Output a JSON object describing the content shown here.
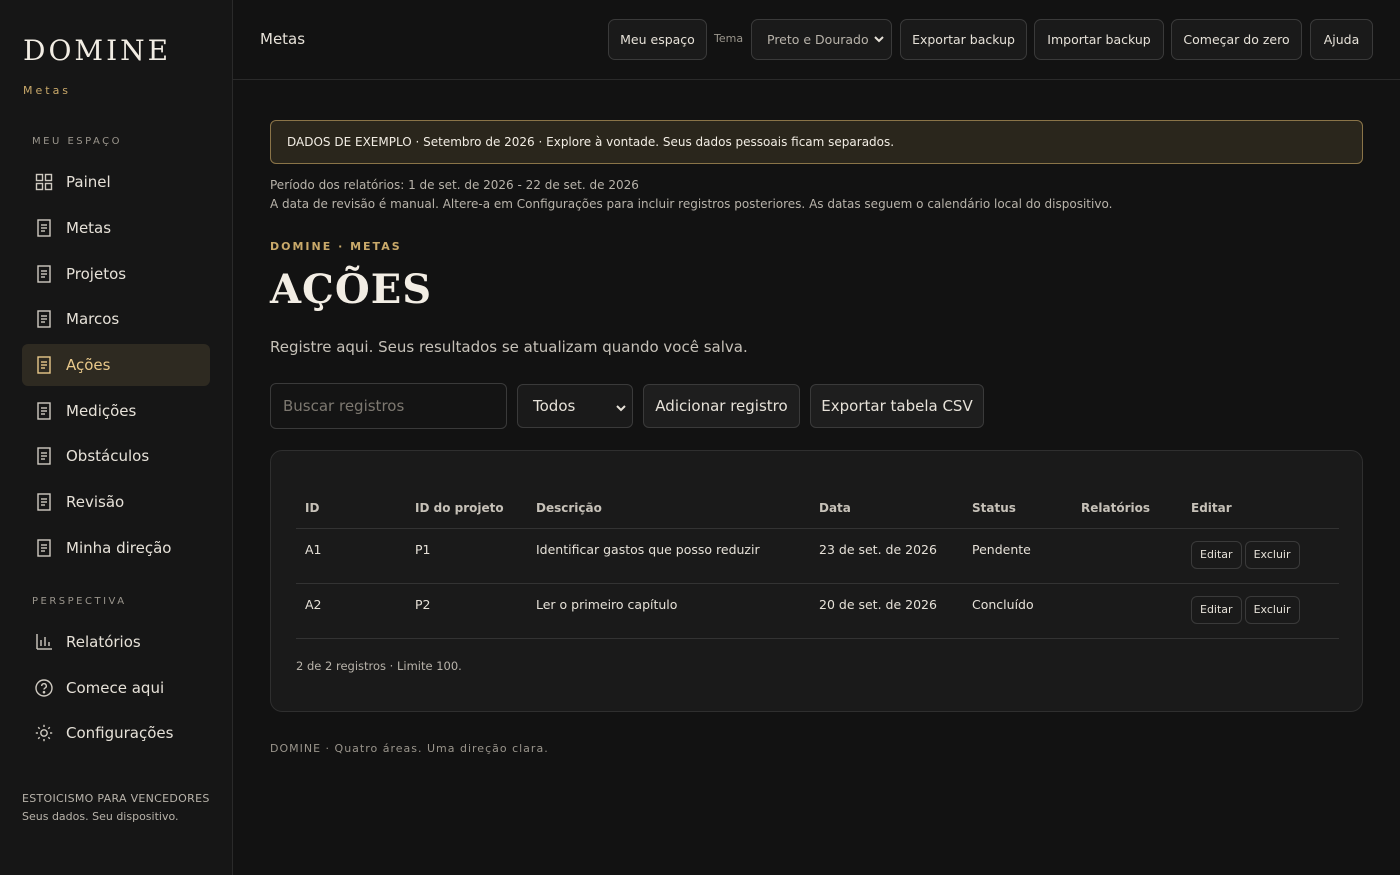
{
  "sidebar": {
    "brand": "DOMINE",
    "brand_sub": "Metas",
    "section_my_space": "MEU ESPAÇO",
    "section_perspective": "PERSPECTIVA",
    "items": [
      {
        "label": "Painel",
        "icon": "grid-icon"
      },
      {
        "label": "Metas",
        "icon": "document-icon"
      },
      {
        "label": "Projetos",
        "icon": "document-icon"
      },
      {
        "label": "Marcos",
        "icon": "document-icon"
      },
      {
        "label": "Ações",
        "icon": "document-icon",
        "active": true
      },
      {
        "label": "Medições",
        "icon": "document-icon"
      },
      {
        "label": "Obstáculos",
        "icon": "document-icon"
      },
      {
        "label": "Revisão",
        "icon": "document-icon"
      },
      {
        "label": "Minha direção",
        "icon": "document-icon"
      }
    ],
    "perspective_items": [
      {
        "label": "Relatórios",
        "icon": "bar-chart-icon"
      },
      {
        "label": "Comece aqui",
        "icon": "help-circle-icon"
      },
      {
        "label": "Configurações",
        "icon": "sun-settings-icon"
      }
    ],
    "footer_line1": "ESTOICISMO PARA VENCEDORES",
    "footer_line2": "Seus dados. Seu dispositivo."
  },
  "topbar": {
    "title": "Metas",
    "my_space": "Meu espaço",
    "theme_label": "Tema",
    "theme_value": "Preto e Dourado",
    "export_backup": "Exportar backup",
    "import_backup": "Importar backup",
    "start_over": "Começar do zero",
    "help": "Ajuda"
  },
  "banner": "DADOS DE EXEMPLO · Setembro de 2026 · Explore à vontade. Seus dados pessoais ficam separados.",
  "report_period": "Período dos relatórios: 1 de set. de 2026 - 22 de set. de 2026",
  "review_note": "A data de revisão é manual. Altere-a em Configurações para incluir registros posteriores. As datas seguem o calendário local do dispositivo.",
  "eyebrow": "DOMINE · METAS",
  "page_title": "AÇÕES",
  "subtitle": "Registre aqui. Seus resultados se atualizam quando você salva.",
  "search_placeholder": "Buscar registros",
  "filter_value": "Todos",
  "add_record": "Adicionar registro",
  "export_csv": "Exportar tabela CSV",
  "table": {
    "headers": [
      "ID",
      "ID do projeto",
      "Descrição",
      "Data",
      "Status",
      "Relatórios",
      "Editar"
    ],
    "rows": [
      {
        "id": "A1",
        "project": "P1",
        "desc": "Identificar gastos que posso reduzir",
        "date": "23 de set. de 2026",
        "status": "Pendente",
        "reports": "",
        "edit": "Editar",
        "delete": "Excluir"
      },
      {
        "id": "A2",
        "project": "P2",
        "desc": "Ler o primeiro capítulo",
        "date": "20 de set. de 2026",
        "status": "Concluído",
        "reports": "",
        "edit": "Editar",
        "delete": "Excluir"
      }
    ],
    "count": "2 de 2 registros · Limite 100."
  },
  "footer": "DOMINE · Quatro áreas. Uma direção clara.",
  "colors": {
    "accent": "#c9a96a",
    "background": "#121212",
    "active_bg": "#2e2a21"
  }
}
